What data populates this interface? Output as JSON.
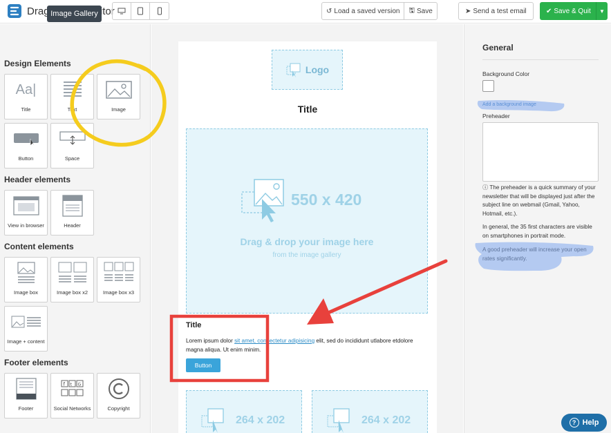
{
  "app": {
    "title": "Drag & Drop Editor"
  },
  "toolbar": {
    "load_label": "Load a saved version",
    "save_label": "Save",
    "send_test_label": "Send a test email",
    "save_quit_label": "Save & Quit"
  },
  "left": {
    "gallery_button": "Image Gallery",
    "sections": [
      {
        "title": "Design Elements",
        "items": [
          "Title",
          "Text",
          "Image",
          "Button",
          "Space"
        ]
      },
      {
        "title": "Header elements",
        "items": [
          "View in browser",
          "Header"
        ]
      },
      {
        "title": "Content elements",
        "items": [
          "Image box",
          "Image box x2",
          "Image box x3",
          "Image + content"
        ]
      },
      {
        "title": "Footer elements",
        "items": [
          "Footer",
          "Social Networks",
          "Copyright"
        ]
      }
    ]
  },
  "canvas": {
    "logo_text": "Logo",
    "title": "Title",
    "big_image_size": "550 x 420",
    "drag_text": "Drag & drop your image here",
    "drag_sub": "from the image gallery",
    "block_title": "Title",
    "lorem_before": "Lorem ipsum dolor ",
    "lorem_link": "sit amet, consectetur adipisicing",
    "lorem_after": " elit, sed do incididunt utlabore etdolore magna aliqua. Ut enim minim.",
    "button_label": "Button",
    "small_image_size_1": "264 x 202",
    "small_image_size_2": "264 x 202"
  },
  "right": {
    "section_title": "General",
    "bg_color_label": "Background Color",
    "bg_image_link": "Add a background image",
    "preheader_label": "Preheader",
    "info_1": "The preheader is a quick summary of your newsletter that will be displayed just after the subject line on webmail (Gmail, Yahoo, Hotmail, etc.).",
    "info_2": "In general, the 35 first characters are visible on smartphones in portrait mode.",
    "info_3": "A good preheader will increase your open rates significantly."
  },
  "help": {
    "label": "Help"
  },
  "colors": {
    "accent_green": "#2bb24c",
    "help_blue": "#1f6fa8",
    "placeholder_bg": "#e5f5fb",
    "annotation_red": "#e8413c",
    "annotation_yellow": "#f5cc1e",
    "highlight_blue": "#7fa8ef"
  }
}
